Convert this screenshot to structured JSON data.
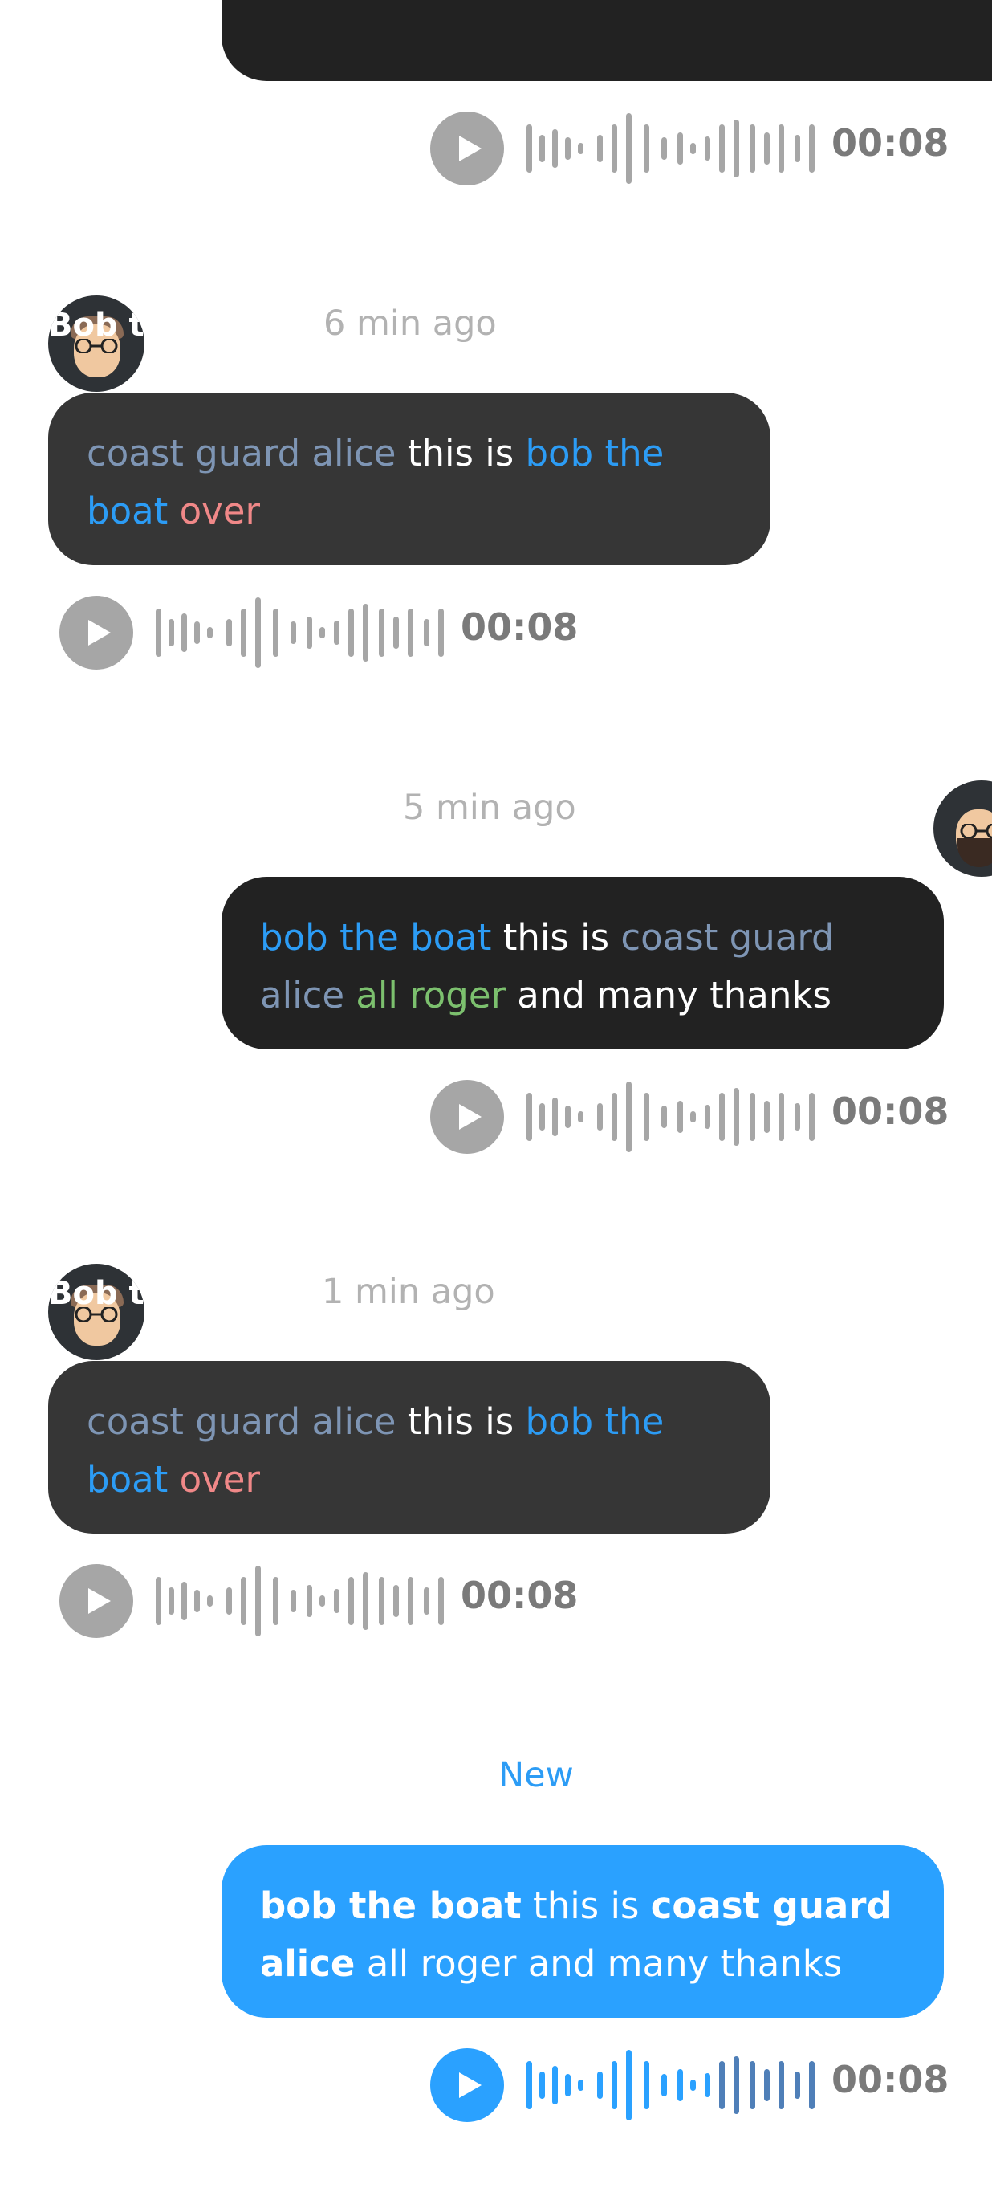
{
  "messages": [
    {
      "id": "m1",
      "side": "right",
      "timestamp": "",
      "text": [],
      "audio": {
        "duration": "00:08"
      }
    },
    {
      "id": "m2",
      "side": "left",
      "avatar_label": "Bob t",
      "timestamp": "6 min ago",
      "text": [
        {
          "t": "coast guard alice",
          "c": "slate"
        },
        {
          "t": " this is ",
          "c": "white"
        },
        {
          "t": "bob the boat",
          "c": "blue"
        },
        {
          "t": "  over",
          "c": "red"
        }
      ],
      "audio": {
        "duration": "00:08"
      }
    },
    {
      "id": "m3",
      "side": "right",
      "timestamp": "5 min ago",
      "text": [
        {
          "t": "bob the boat",
          "c": "blue"
        },
        {
          "t": " this is ",
          "c": "white"
        },
        {
          "t": "coast guard alice",
          "c": "slate"
        },
        {
          "t": " all roger",
          "c": "green"
        },
        {
          "t": " and many thanks",
          "c": "white"
        }
      ],
      "audio": {
        "duration": "00:08"
      }
    },
    {
      "id": "m4",
      "side": "left",
      "avatar_label": "Bob t",
      "timestamp": "1 min ago",
      "text": [
        {
          "t": "coast guard alice",
          "c": "slate"
        },
        {
          "t": " this is ",
          "c": "white"
        },
        {
          "t": "bob the boat",
          "c": "blue"
        },
        {
          "t": "  over",
          "c": "red"
        }
      ],
      "audio": {
        "duration": "00:08"
      }
    },
    {
      "id": "m5",
      "side": "right",
      "timestamp": "New",
      "text": [
        {
          "t": "bob the boat",
          "c": "bold"
        },
        {
          "t": " this is ",
          "c": "white"
        },
        {
          "t": "coast guard alice",
          "c": "bold"
        },
        {
          "t": " all roger and many thanks",
          "c": "white"
        }
      ],
      "audio": {
        "duration": "00:08",
        "progress_fraction": 0.33
      }
    }
  ],
  "colors": {
    "bubble_other": "#363636",
    "bubble_me": "#222222",
    "bubble_new": "#2aa1ff",
    "waveform_idle": "#a6a6a6",
    "waveform_played": "#2aa1ff",
    "waveform_unplayed_new": "#4f7fb8"
  }
}
